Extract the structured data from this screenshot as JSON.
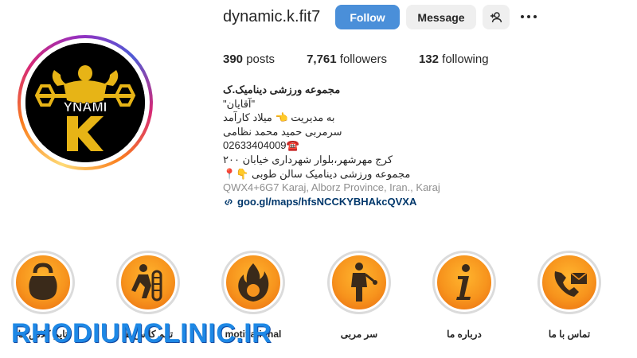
{
  "profile": {
    "username": "dynamic.k.fit7",
    "follow_label": "Follow",
    "message_label": "Message",
    "stats": {
      "posts_count": "390",
      "posts_label": "posts",
      "followers_count": "7,761",
      "followers_label": "followers",
      "following_count": "132",
      "following_label": "following"
    },
    "avatar_text": "YNAMI"
  },
  "bio": {
    "name": "مجموعه ورزشی دینامیک.ک",
    "lines": [
      "\"آقایان\"",
      "به مدیریت 👈 میلاد کارآمد",
      "سرمربی حمید محمد نظامی",
      "02633404009☎️",
      "کرج مهرشهر،بلوار شهرداری خیابان ۲۰۰",
      "مجموعه ورزشی دینامیک سالن طوبی 👇📍"
    ],
    "address": "QWX4+6G7 Karaj, Alborz Province, Iran., Karaj",
    "link": "goo.gl/maps/hfsNCCKYBHAkcQVXA"
  },
  "highlights": [
    {
      "label": "تایم کلاس ها",
      "icon": "kettlebell-icon"
    },
    {
      "label": "تایم کلاس ها",
      "icon": "workout-icon"
    },
    {
      "label": "motivational",
      "icon": "flame-icon"
    },
    {
      "label": "سر مربی",
      "icon": "coach-icon"
    },
    {
      "label": "درباره ما",
      "icon": "info-icon"
    },
    {
      "label": "تماس با ما",
      "icon": "contact-icon"
    }
  ],
  "watermark": "RHODIUMCLINIC.IR",
  "colors": {
    "follow_button": "#4a8fd9",
    "link": "#00376b",
    "highlight_orange": "#f7941d",
    "watermark": "#1e88e5"
  }
}
